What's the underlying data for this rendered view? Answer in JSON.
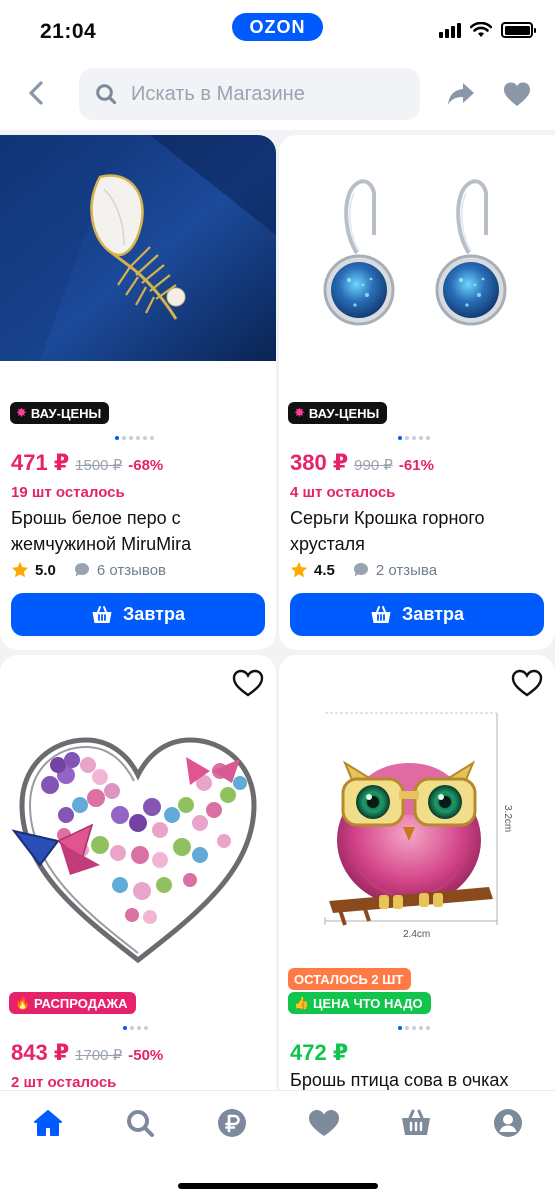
{
  "status_bar": {
    "time": "21:04",
    "logo": "OZON"
  },
  "search": {
    "placeholder": "Искать в Магазине"
  },
  "products": [
    {
      "badge": "ВАУ-ЦЕНЫ",
      "price": "471 ₽",
      "old_price": "1500 ₽",
      "discount": "-68%",
      "stock": "19 шт осталось",
      "title": "Брошь белое перо с жемчужиной MiruMira",
      "rating": "5.0",
      "reviews": "6 отзывов",
      "button": "Завтра"
    },
    {
      "badge": "ВАУ-ЦЕНЫ",
      "price": "380 ₽",
      "old_price": "990 ₽",
      "discount": "-61%",
      "stock": "4 шт осталось",
      "title": "Серьги Крошка горного хрусталя",
      "rating": "4.5",
      "reviews": "2 отзыва",
      "button": "Завтра"
    },
    {
      "badge": "РАСПРОДАЖА",
      "price": "843 ₽",
      "old_price": "1700 ₽",
      "discount": "-50%",
      "stock": "2 шт осталось"
    },
    {
      "badge": "ОСТАЛОСЬ 2 ШТ",
      "badge2": "ЦЕНА ЧТО НАДО",
      "price": "472 ₽",
      "title": "Брошь птица сова в очках",
      "dim_width": "2.4cm",
      "dim_height": "3.2cm"
    }
  ],
  "bottom_nav": [
    "home-icon",
    "search-icon",
    "points-icon",
    "favorites-icon",
    "cart-icon",
    "profile-icon"
  ],
  "colors": {
    "accent": "#005bff",
    "sale": "#e6226b",
    "green": "#10c44c"
  }
}
